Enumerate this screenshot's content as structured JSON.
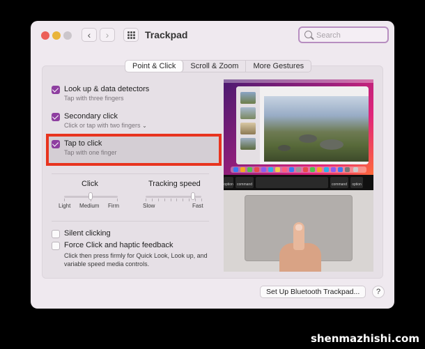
{
  "window": {
    "title": "Trackpad"
  },
  "nav": {
    "back_glyph": "‹",
    "forward_glyph": "›"
  },
  "search": {
    "placeholder": "Search",
    "value": ""
  },
  "tabs": [
    {
      "label": "Point & Click",
      "active": true
    },
    {
      "label": "Scroll & Zoom",
      "active": false
    },
    {
      "label": "More Gestures",
      "active": false
    }
  ],
  "options": [
    {
      "label": "Look up & data detectors",
      "desc": "Tap with three fingers",
      "checked": true
    },
    {
      "label": "Secondary click",
      "desc": "Click or tap with two fingers",
      "checked": true,
      "has_dropdown": true
    },
    {
      "label": "Tap to click",
      "desc": "Tap with one finger",
      "checked": true,
      "highlighted": true
    }
  ],
  "sliders": {
    "click": {
      "title": "Click",
      "labels": [
        "Light",
        "Medium",
        "Firm"
      ],
      "value": "Medium"
    },
    "tracking": {
      "title": "Tracking speed",
      "labels": [
        "Slow",
        "Fast"
      ],
      "value_fraction": 0.85
    }
  },
  "lower_options": [
    {
      "label": "Silent clicking",
      "checked": false
    },
    {
      "label": "Force Click and haptic feedback",
      "checked": false
    }
  ],
  "force_click_desc": "Click then press firmly for Quick Look, Look up, and variable speed media controls.",
  "preview": {
    "keys": [
      "command",
      "option",
      "command",
      "option"
    ]
  },
  "buttons": {
    "bluetooth": "Set Up Bluetooth Trackpad...",
    "help": "?"
  },
  "watermark": "shenmazhishi.com",
  "colors": {
    "accent": "#8e3fa0",
    "highlight_border": "#e8341f",
    "search_focus": "#b78ec0"
  },
  "icons": [
    "back-chevron-icon",
    "forward-chevron-icon",
    "grid-icon",
    "search-icon",
    "checkbox-checked-icon",
    "chevron-down-icon"
  ]
}
